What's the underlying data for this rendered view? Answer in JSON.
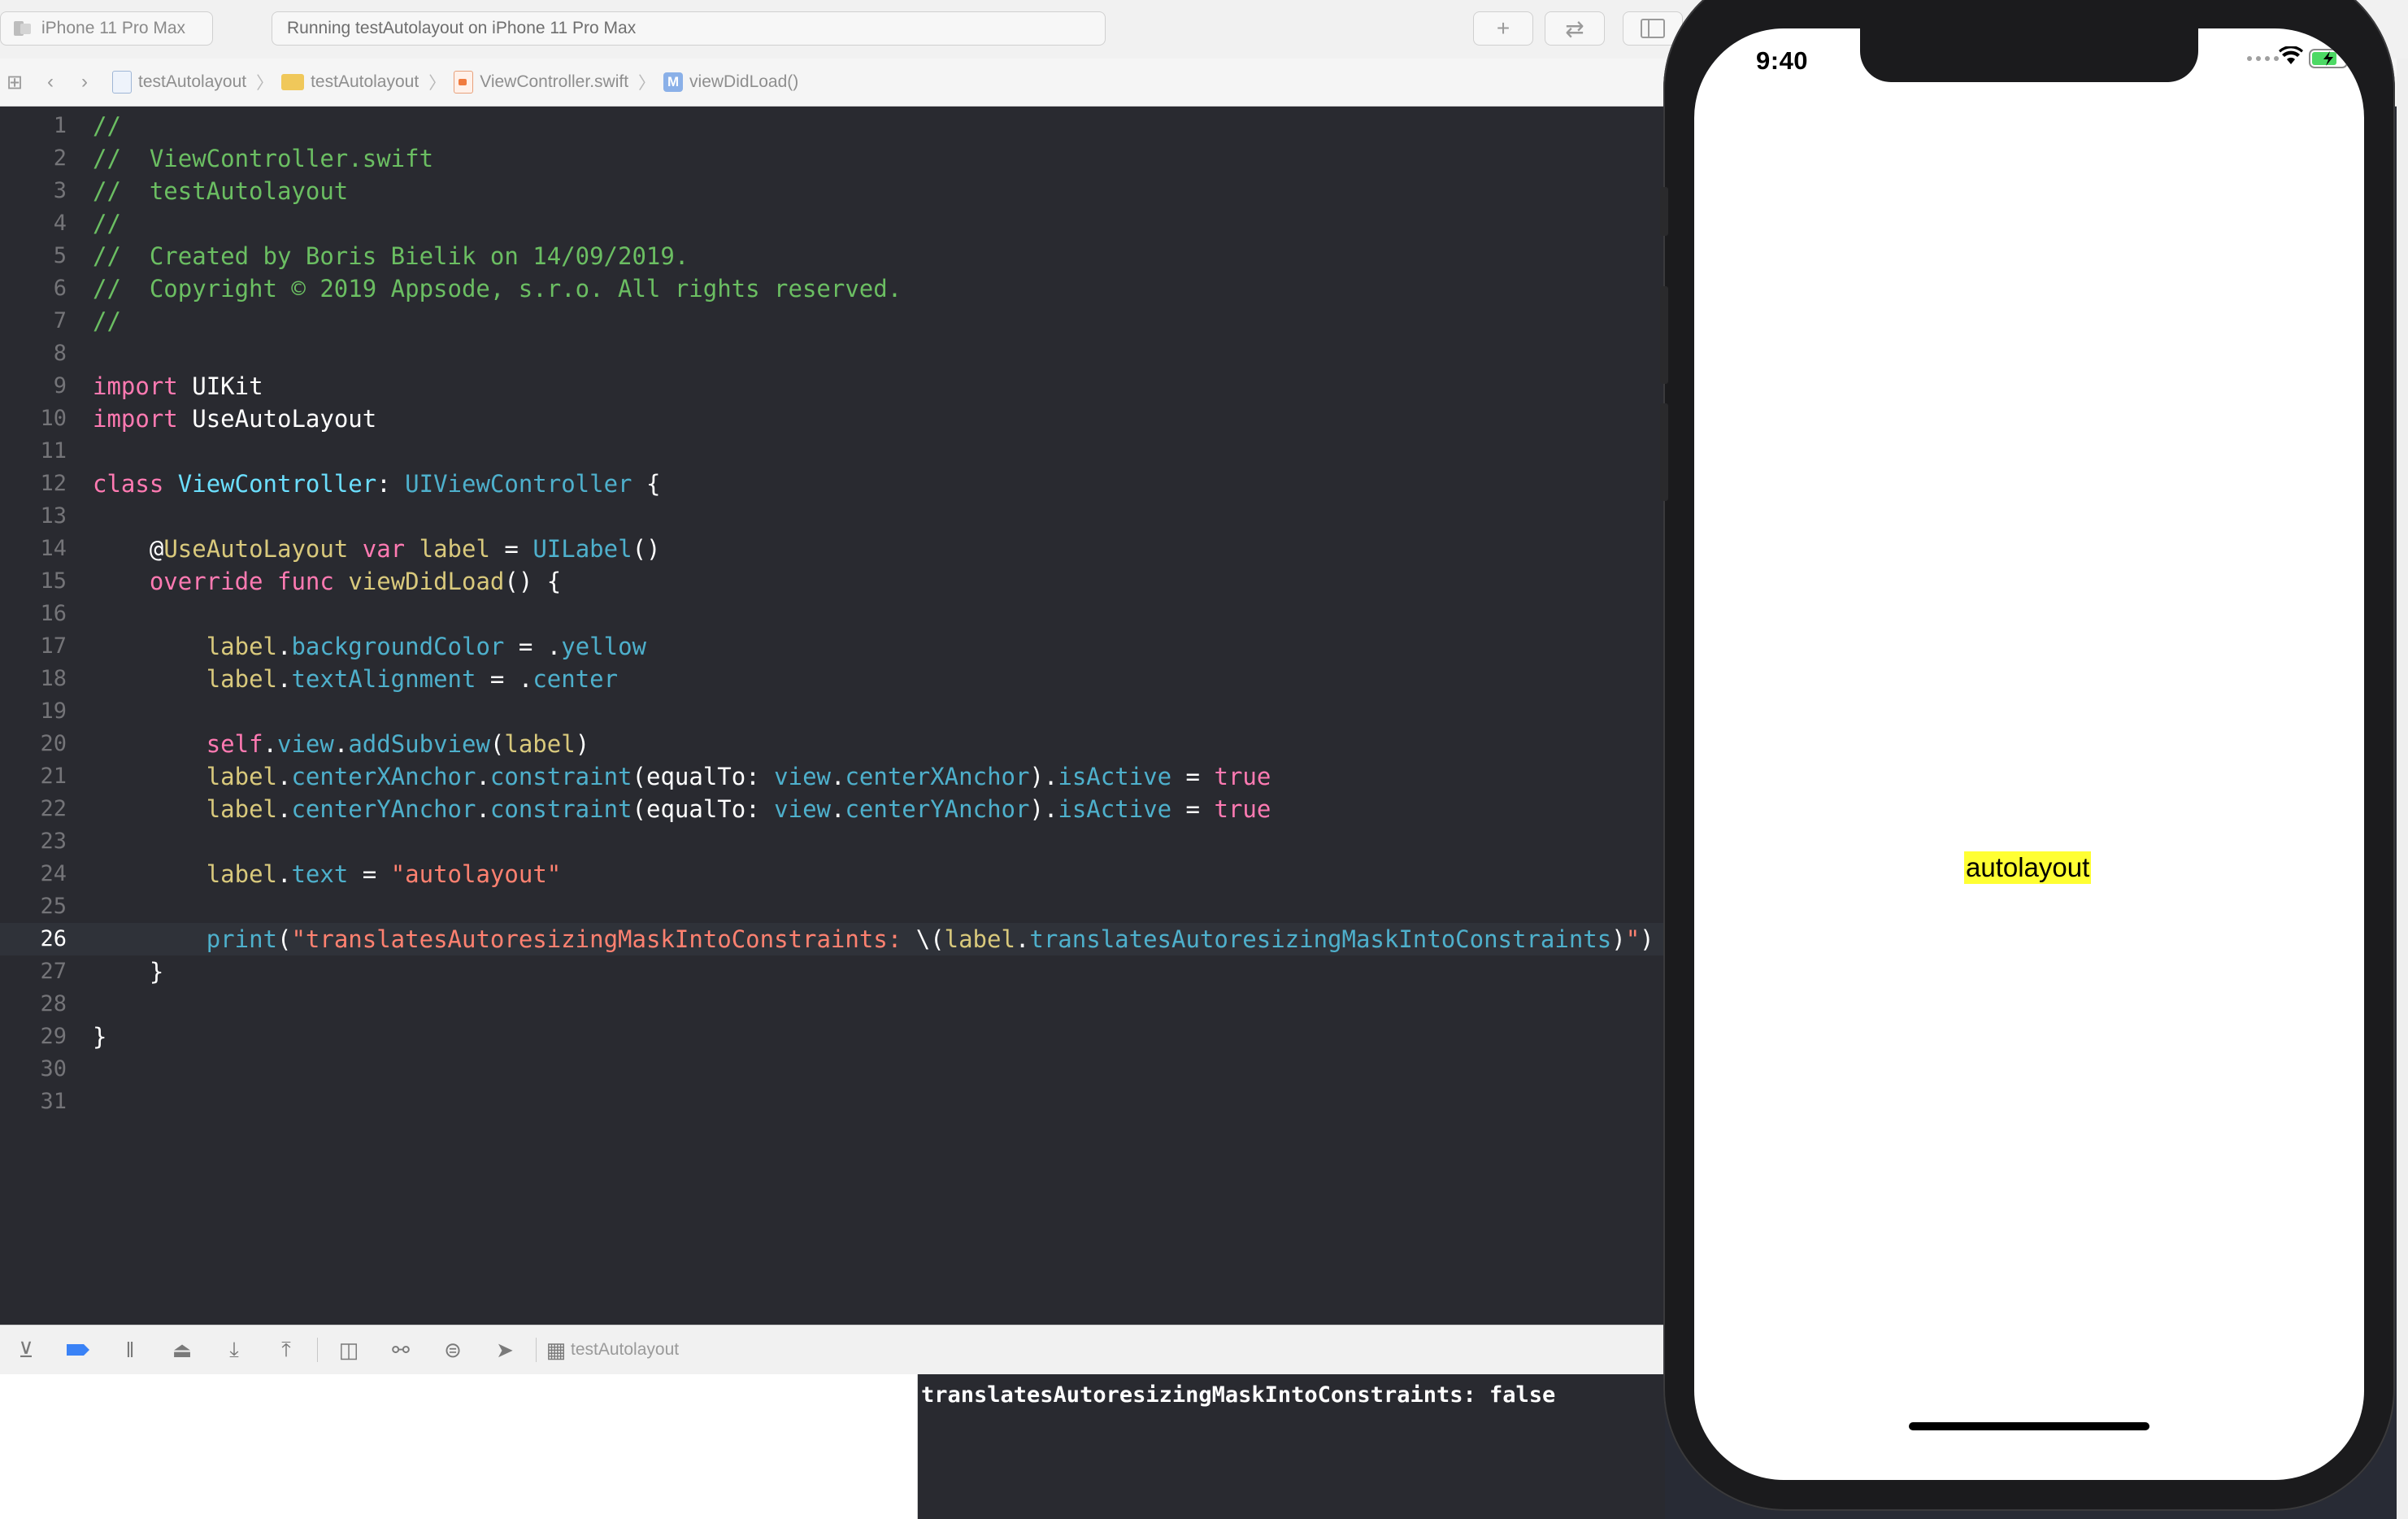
{
  "toolbar": {
    "scheme_device": "iPhone 11 Pro Max",
    "status": "Running testAutolayout on iPhone 11 Pro Max"
  },
  "jumpbar": {
    "crumbs": [
      "testAutolayout",
      "testAutolayout",
      "ViewController.swift",
      "viewDidLoad()"
    ],
    "method_badge": "M"
  },
  "editor": {
    "current_line": 26,
    "lines": [
      {
        "n": "1"
      },
      {
        "n": "2"
      },
      {
        "n": "3"
      },
      {
        "n": "4"
      },
      {
        "n": "5"
      },
      {
        "n": "6"
      },
      {
        "n": "7"
      },
      {
        "n": "8"
      },
      {
        "n": "9"
      },
      {
        "n": "10"
      },
      {
        "n": "11"
      },
      {
        "n": "12"
      },
      {
        "n": "13"
      },
      {
        "n": "14"
      },
      {
        "n": "15"
      },
      {
        "n": "16"
      },
      {
        "n": "17"
      },
      {
        "n": "18"
      },
      {
        "n": "19"
      },
      {
        "n": "20"
      },
      {
        "n": "21"
      },
      {
        "n": "22"
      },
      {
        "n": "23"
      },
      {
        "n": "24"
      },
      {
        "n": "25"
      },
      {
        "n": "26"
      },
      {
        "n": "27"
      },
      {
        "n": "28"
      },
      {
        "n": "29"
      },
      {
        "n": "30"
      },
      {
        "n": "31"
      }
    ],
    "code": {
      "l1": "//",
      "l2": "//  ViewController.swift",
      "l3": "//  testAutolayout",
      "l4": "//",
      "l5": "//  Created by Boris Bielik on 14/09/2019.",
      "l6": "//  Copyright © 2019 Appsode, s.r.o. All rights reserved.",
      "l7": "//",
      "import": "import",
      "uikit": "UIKit",
      "useautolayout_mod": "UseAutoLayout",
      "class_kw": "class",
      "class_name": "ViewController",
      "colon": ":",
      "superclass": "UIViewController",
      "brace_open": "{",
      "brace_close": "}",
      "at": "@",
      "attr": "UseAutoLayout",
      "var_kw": "var",
      "label": "label",
      "eq": "=",
      "uilabel": "UILabel",
      "parens": "()",
      "override_kw": "override",
      "func_kw": "func",
      "viewdidload": "viewDidLoad",
      "dot": ".",
      "backgroundColor": "backgroundColor",
      "yellow": "yellow",
      "textAlignment": "textAlignment",
      "center": "center",
      "self_kw": "self",
      "view": "view",
      "addSubview": "addSubview",
      "paren_open": "(",
      "paren_close": ")",
      "centerXAnchor": "centerXAnchor",
      "centerYAnchor": "centerYAnchor",
      "constraint": "constraint",
      "equalTo": "equalTo:",
      "isActive": "isActive",
      "true_kw": "true",
      "text": "text",
      "str_autolayout": "\"autolayout\"",
      "print": "print",
      "str_translates_open": "\"translatesAutoresizingMaskIntoConstraints: ",
      "interp_open": "\\(",
      "translatesProp": "translatesAutoresizingMaskIntoConstraints",
      "str_close": "\""
    }
  },
  "debugbar": {
    "target": "testAutolayout"
  },
  "console": {
    "output": "translatesAutoresizingMaskIntoConstraints: false"
  },
  "simulator": {
    "time": "9:40",
    "label_text": "autolayout",
    "label_bg": "#ffff33"
  },
  "colors": {
    "editor_bg": "#292a30",
    "comment": "#6bbe62",
    "keyword": "#ff7ab2",
    "type": "#5dd8ff",
    "string": "#ff8170",
    "property": "#4eb0cc"
  }
}
